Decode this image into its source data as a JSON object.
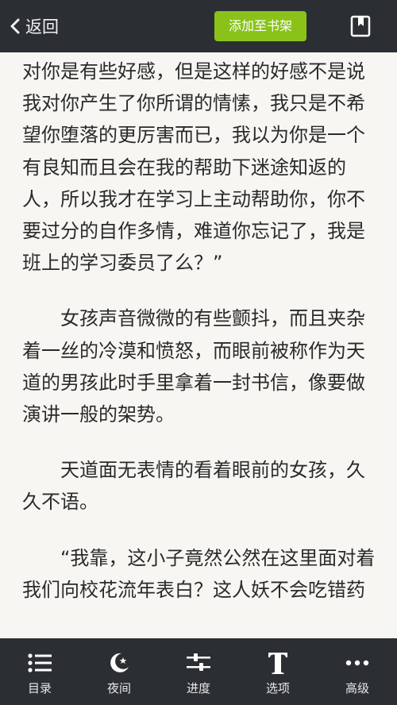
{
  "header": {
    "back_label": "返回",
    "add_label": "添加至书架"
  },
  "content": {
    "paragraphs": [
      "对你是有些好感，但是这样的好感不是说我对你产生了你所谓的情愫，我只是不希望你堕落的更厉害而已，我以为你是一个有良知而且会在我的帮助下迷途知返的人，所以我才在学习上主动帮助你，你不要过分的自作多情，难道你忘记了，我是班上的学习委员了么？”",
      "女孩声音微微的有些颤抖，而且夹杂着一丝的冷漠和愤怒，而眼前被称作为天道的男孩此时手里拿着一封书信，像要做演讲一般的架势。",
      "天道面无表情的看着眼前的女孩，久久不语。",
      "“我靠，这小子竟然公然在这里面对着我们向校花流年表白？这人妖不会吃错药"
    ]
  },
  "toolbar": {
    "items": [
      {
        "label": "目录",
        "icon": "list-icon"
      },
      {
        "label": "夜间",
        "icon": "moon-icon"
      },
      {
        "label": "进度",
        "icon": "progress-icon"
      },
      {
        "label": "选项",
        "icon": "text-icon"
      },
      {
        "label": "高级",
        "icon": "more-icon"
      }
    ]
  },
  "colors": {
    "bar": "#2b2f33",
    "accent": "#8ac21a",
    "page": "#f7f6f2"
  }
}
